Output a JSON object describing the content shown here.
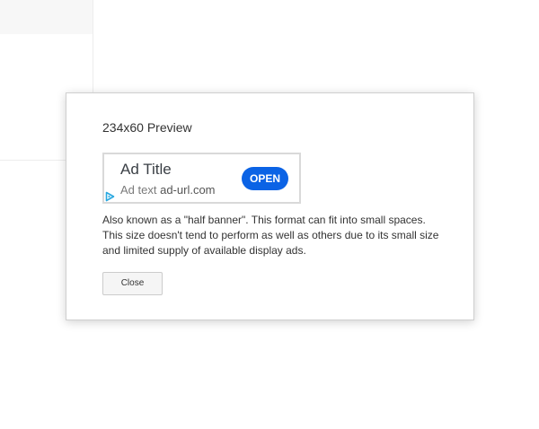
{
  "dialog": {
    "title": "234x60 Preview",
    "description": "Also known as a \"half banner\". This format can fit into small spaces. This size doesn't tend to perform as well as others due to its small size and limited supply of available display ads.",
    "close_label": "Close"
  },
  "ad": {
    "title": "Ad Title",
    "text": "Ad text",
    "url": "ad-url.com",
    "cta_label": "OPEN",
    "adchoices_icon": "adchoices-icon",
    "colors": {
      "cta_background": "#0b63e5",
      "cta_text": "#ffffff",
      "adchoices": "#29a8e0"
    }
  }
}
